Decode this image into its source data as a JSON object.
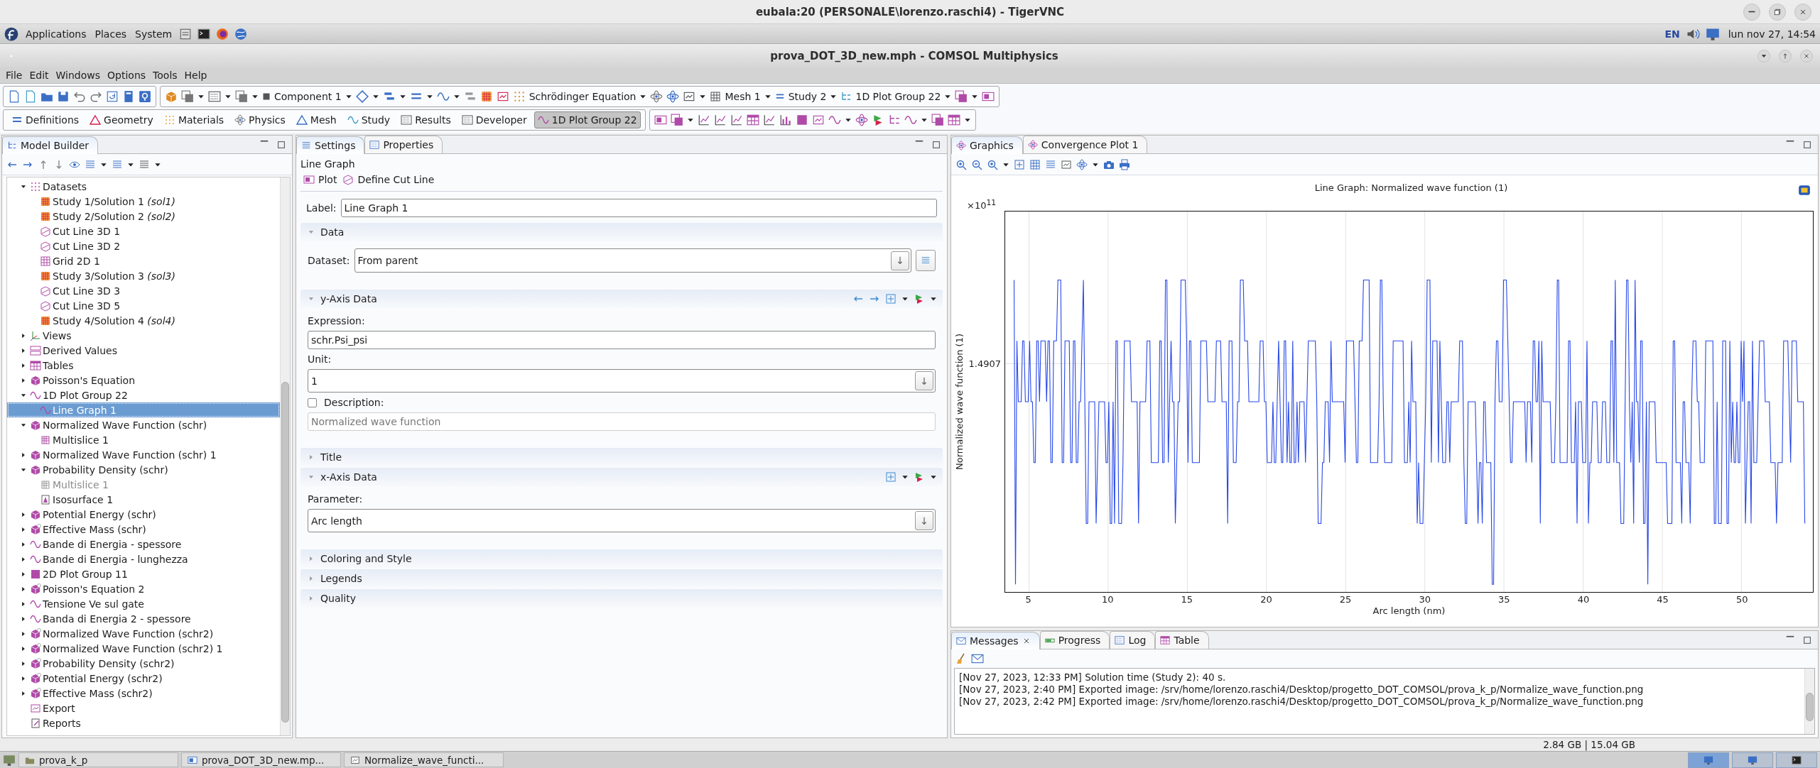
{
  "vnc_window": {
    "title": "eubala:20 (PERSONALE\\lorenzo.raschi4) - TigerVNC"
  },
  "top_panel": {
    "menus": [
      "Applications",
      "Places",
      "System"
    ],
    "keyboard_layout": "EN",
    "clock": "lun nov 27, 14:54"
  },
  "window": {
    "title": "prova_DOT_3D_new.mph - COMSOL Multiphysics"
  },
  "menu": [
    "File",
    "Edit",
    "Windows",
    "Options",
    "Tools",
    "Help"
  ],
  "toolbar": {
    "buttons": [
      "Component 1",
      "Schrödinger Equation",
      "Mesh 1",
      "Study 2",
      "1D Plot Group 22"
    ]
  },
  "ribbon": {
    "tabs": [
      {
        "label": "Definitions",
        "selected": false
      },
      {
        "label": "Geometry",
        "selected": false
      },
      {
        "label": "Materials",
        "selected": false
      },
      {
        "label": "Physics",
        "selected": false
      },
      {
        "label": "Mesh",
        "selected": false
      },
      {
        "label": "Study",
        "selected": false
      },
      {
        "label": "Results",
        "selected": false
      },
      {
        "label": "Developer",
        "selected": false
      },
      {
        "label": "1D Plot Group 22",
        "selected": true
      }
    ]
  },
  "model_builder": {
    "tab": {
      "label": "Model Builder",
      "selected": true
    },
    "tree": [
      {
        "label": "Datasets",
        "kind": "datasets",
        "expanded": true,
        "selected": false,
        "disabled": false,
        "children": [
          {
            "label": "Study 1/Solution 1 *(sol1)*",
            "kind": "solution",
            "selected": false,
            "disabled": false
          },
          {
            "label": "Study 2/Solution 2 *(sol2)*",
            "kind": "solution",
            "selected": false,
            "disabled": false
          },
          {
            "label": "Cut Line 3D 1",
            "kind": "cutline",
            "selected": false,
            "disabled": false
          },
          {
            "label": "Cut Line 3D 2",
            "kind": "cutline",
            "selected": false,
            "disabled": false
          },
          {
            "label": "Grid 2D 1",
            "kind": "grid",
            "selected": false,
            "disabled": false
          },
          {
            "label": "Study 3/Solution 3 *(sol3)*",
            "kind": "solution",
            "selected": false,
            "disabled": false
          },
          {
            "label": "Cut Line 3D 3",
            "kind": "cutline",
            "selected": false,
            "disabled": false
          },
          {
            "label": "Cut Line 3D 5",
            "kind": "cutline",
            "selected": false,
            "disabled": false
          },
          {
            "label": "Study 4/Solution 4 *(sol4)*",
            "kind": "solution",
            "selected": false,
            "disabled": false
          }
        ]
      },
      {
        "label": "Views",
        "kind": "views",
        "expanded": false,
        "selected": false,
        "disabled": false
      },
      {
        "label": "Derived Values",
        "kind": "derived",
        "expanded": false,
        "selected": false,
        "disabled": false
      },
      {
        "label": "Tables",
        "kind": "tables",
        "expanded": false,
        "selected": false,
        "disabled": false
      },
      {
        "label": "Poisson's Equation",
        "kind": "group3d",
        "expanded": false,
        "selected": false,
        "disabled": false
      },
      {
        "label": "1D Plot Group 22",
        "kind": "group1d",
        "expanded": true,
        "selected": false,
        "disabled": false,
        "children": [
          {
            "label": "Line Graph 1",
            "kind": "group1d",
            "selected": true,
            "disabled": false
          }
        ]
      },
      {
        "label": "Normalized Wave Function (schr)",
        "kind": "group3d",
        "expanded": true,
        "selected": false,
        "disabled": false,
        "children": [
          {
            "label": "Multislice 1",
            "kind": "multislice",
            "selected": false,
            "disabled": false
          }
        ]
      },
      {
        "label": "Normalized Wave Function (schr) 1",
        "kind": "group3d",
        "expanded": false,
        "selected": false,
        "disabled": false
      },
      {
        "label": "Probability Density (schr)",
        "kind": "group3d",
        "expanded": true,
        "selected": false,
        "disabled": false,
        "children": [
          {
            "label": "Multislice 1",
            "kind": "multislice",
            "selected": false,
            "disabled": true
          },
          {
            "label": "Isosurface 1",
            "kind": "isosurface",
            "selected": false,
            "disabled": false
          }
        ]
      },
      {
        "label": "Potential Energy (schr)",
        "kind": "group3d",
        "expanded": false,
        "selected": false,
        "disabled": false
      },
      {
        "label": "Effective Mass (schr)",
        "kind": "group3d-star",
        "expanded": false,
        "selected": false,
        "disabled": false
      },
      {
        "label": "Bande di Energia - spessore",
        "kind": "group1d",
        "expanded": false,
        "selected": false,
        "disabled": false
      },
      {
        "label": "Bande di Energia - lunghezza",
        "kind": "group1d",
        "expanded": false,
        "selected": false,
        "disabled": false
      },
      {
        "label": "2D Plot Group 11",
        "kind": "group2d",
        "expanded": false,
        "selected": false,
        "disabled": false
      },
      {
        "label": "Poisson's Equation 2",
        "kind": "group3d-star",
        "expanded": false,
        "selected": false,
        "disabled": false
      },
      {
        "label": "Tensione Ve sul gate",
        "kind": "group1d",
        "expanded": false,
        "selected": false,
        "disabled": false
      },
      {
        "label": "Banda di Energia 2 - spessore",
        "kind": "group1d",
        "expanded": false,
        "selected": false,
        "disabled": false
      },
      {
        "label": "Normalized Wave Function (schr2)",
        "kind": "group3d-star",
        "expanded": false,
        "selected": false,
        "disabled": false
      },
      {
        "label": "Normalized Wave Function (schr2) 1",
        "kind": "group3d-star",
        "expanded": false,
        "selected": false,
        "disabled": false
      },
      {
        "label": "Probability Density (schr2)",
        "kind": "group3d-star",
        "expanded": false,
        "selected": false,
        "disabled": false
      },
      {
        "label": "Potential Energy (schr2)",
        "kind": "group3d-star",
        "expanded": false,
        "selected": false,
        "disabled": false
      },
      {
        "label": "Effective Mass (schr2)",
        "kind": "group3d-star",
        "expanded": false,
        "selected": false,
        "disabled": false
      },
      {
        "label": "Export",
        "kind": "export",
        "selected": false,
        "disabled": false
      },
      {
        "label": "Reports",
        "kind": "reports",
        "selected": false,
        "disabled": false
      }
    ]
  },
  "settings": {
    "tabs": [
      {
        "label": "Settings",
        "selected": true
      },
      {
        "label": "Properties",
        "selected": false
      }
    ],
    "heading": "Line Graph",
    "actions": [
      "Plot",
      "Define Cut Line"
    ],
    "label_field": {
      "label": "Label:",
      "value": "Line Graph 1"
    },
    "sections": [
      {
        "title": "Data",
        "expanded": true,
        "fields": [
          {
            "kind": "inline-combo",
            "label": "Dataset:",
            "value": "From parent"
          }
        ]
      },
      {
        "title": "y-Axis Data",
        "expanded": true,
        "nav_arrows": true,
        "options_menu": true,
        "fields": [
          {
            "kind": "text",
            "label": "Expression:",
            "value": "schr.Psi_psi"
          },
          {
            "kind": "combo",
            "label": "Unit:",
            "value": "1"
          },
          {
            "kind": "checkbox-text",
            "label": "Description:",
            "checked": false,
            "value": "Normalized wave function"
          }
        ]
      },
      {
        "title": "Title",
        "expanded": false
      },
      {
        "title": "x-Axis Data",
        "expanded": true,
        "nav_arrows": false,
        "options_menu": true,
        "fields": [
          {
            "kind": "combo",
            "label": "Parameter:",
            "value": "Arc length"
          }
        ]
      },
      {
        "title": "Coloring and Style",
        "expanded": false
      },
      {
        "title": "Legends",
        "expanded": false
      },
      {
        "title": "Quality",
        "expanded": false
      }
    ]
  },
  "graphics": {
    "tabs": [
      {
        "label": "Graphics",
        "selected": true
      },
      {
        "label": "Convergence Plot 1",
        "selected": false
      }
    ],
    "plot": {
      "title": "Line Graph: Normalized wave function (1)",
      "y_scale": "×10$^{11}$",
      "ylabel": "Normalized wave function (1)",
      "yticks": [
        "1.4907"
      ],
      "xlabel": "Arc length (nm)",
      "xticks": [
        "5",
        "10",
        "15",
        "20",
        "25",
        "30",
        "35",
        "40",
        "45",
        "50"
      ]
    }
  },
  "messages": {
    "tabs": [
      {
        "label": "Messages",
        "selected": true
      },
      {
        "label": "Progress",
        "selected": false
      },
      {
        "label": "Log",
        "selected": false
      },
      {
        "label": "Table",
        "selected": false
      }
    ],
    "lines": [
      "[Nov 27, 2023, 12:33 PM] Solution time (Study 2): 40 s.",
      "[Nov 27, 2023, 2:40 PM] Exported image: /srv/home/lorenzo.raschi4/Desktop/progetto_DOT_COMSOL/prova_k_p/Normalize_wave_function.png",
      "[Nov 27, 2023, 2:42 PM] Exported image: /srv/home/lorenzo.raschi4/Desktop/progetto_DOT_COMSOL/prova_k_p/Normalize_wave_function.png"
    ]
  },
  "status_bar": {
    "memory": "2.84 GB | 15.04 GB"
  },
  "taskbar": {
    "items": [
      {
        "label": "prova_k_p",
        "kind": "folder"
      },
      {
        "label": "prova_DOT_3D_new.mp...",
        "kind": "app"
      },
      {
        "label": "Normalize_wave_functi...",
        "kind": "image"
      }
    ]
  }
}
